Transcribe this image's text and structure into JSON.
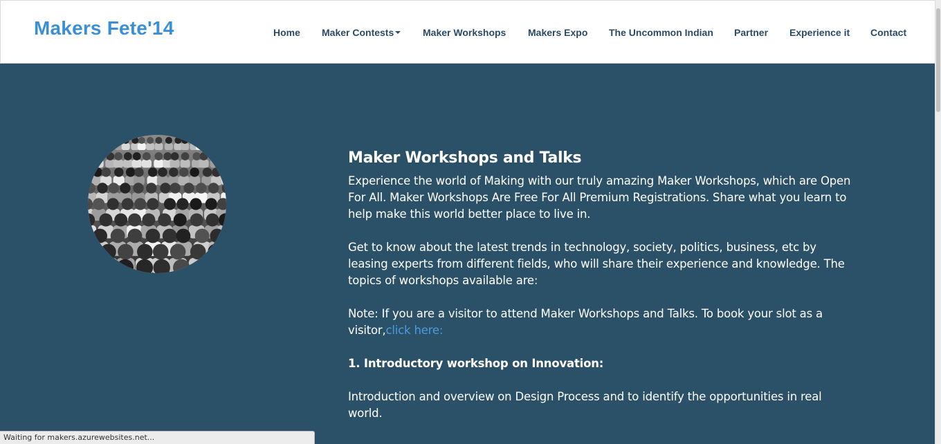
{
  "header": {
    "brand": "Makers Fete'14",
    "nav": [
      {
        "label": "Home"
      },
      {
        "label": "Maker Contests",
        "has_dropdown": true
      },
      {
        "label": "Maker Workshops"
      },
      {
        "label": "Makers Expo"
      },
      {
        "label": "The Uncommon Indian"
      },
      {
        "label": "Partner"
      },
      {
        "label": "Experience it"
      },
      {
        "label": "Contact"
      }
    ]
  },
  "main": {
    "title": "Maker Workshops and Talks",
    "paragraph_1": "Experience the world of Making with our truly amazing Maker Workshops, which are Open For All. Maker Workshops Are Free For All Premium Registrations. Share what you learn to help make this world better place to live in.",
    "paragraph_2": "Get to know about the latest trends in technology, society, politics, business, etc by leasing experts from different fields, who will share their experience and knowledge. The topics of workshops available are:",
    "note_text": "Note: If you are a visitor to attend Maker Workshops and Talks. To book your slot as a visitor,",
    "note_link": "click here:",
    "item_1_heading": "1. Introductory workshop on Innovation:",
    "item_1_text": "Introduction and overview on Design Process and to identify the opportunities in real world."
  },
  "status_bar": {
    "text": "Waiting for makers.azurewebsites.net..."
  },
  "colors": {
    "brand": "#3b8fd6",
    "nav_text": "#2c4a66",
    "hero_bg": "#2b5168",
    "link": "#4a9be0"
  }
}
